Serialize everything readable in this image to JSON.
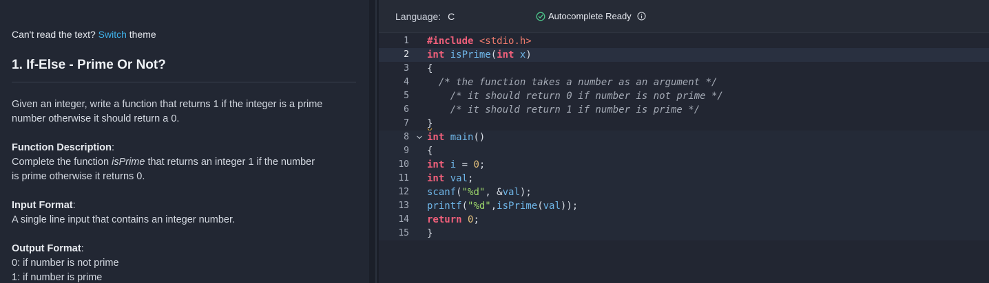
{
  "problem": {
    "theme_prompt": "Can't read the text?",
    "theme_link": "Switch",
    "theme_suffix": "theme",
    "title": "1. If-Else - Prime Or Not?",
    "description_1": "Given an integer, write a function that returns 1 if the integer is a prime",
    "description_2": "number otherwise it should return a 0.",
    "function_heading": "Function Description",
    "function_text_1a": "Complete the function ",
    "function_name": "isPrime",
    "function_text_1b": " that returns an integer 1 if the number",
    "function_text_2": "is prime otherwise it returns 0.",
    "input_heading": "Input Format",
    "input_text": "A single line input that contains an integer number.",
    "output_heading": "Output Format",
    "output_line_1": "0: if number is not prime",
    "output_line_2": "1: if number is prime"
  },
  "editor": {
    "language_label": "Language:",
    "language_value": "C",
    "status_text": "Autocomplete Ready",
    "active_line": 2,
    "lines": [
      {
        "n": "1",
        "text": "#include <stdio.h>"
      },
      {
        "n": "2",
        "text": "int isPrime(int x)"
      },
      {
        "n": "3",
        "text": "{"
      },
      {
        "n": "4",
        "text": "  /* the function takes a number as an argument */"
      },
      {
        "n": "5",
        "text": "    /* it should return 0 if number is not prime */"
      },
      {
        "n": "6",
        "text": "    /* it should return 1 if number is prime */"
      },
      {
        "n": "7",
        "text": "}"
      },
      {
        "n": "8",
        "text": "int main()"
      },
      {
        "n": "9",
        "text": "{"
      },
      {
        "n": "10",
        "text": "int i = 0;"
      },
      {
        "n": "11",
        "text": "int val;"
      },
      {
        "n": "12",
        "text": "scanf(\"%d\", &val);"
      },
      {
        "n": "13",
        "text": "printf(\"%d\",isPrime(val));"
      },
      {
        "n": "14",
        "text": "return 0;"
      },
      {
        "n": "15",
        "text": "}"
      }
    ]
  },
  "colors": {
    "keyword": "#ef5f7a",
    "function": "#6fb6e8",
    "string": "#9bd46a",
    "comment": "#a3a9b4",
    "link": "#3fb0e8",
    "status_check": "#4cc38a"
  },
  "icons": [
    "check-circle-icon",
    "info-icon",
    "chevron-down-icon"
  ]
}
